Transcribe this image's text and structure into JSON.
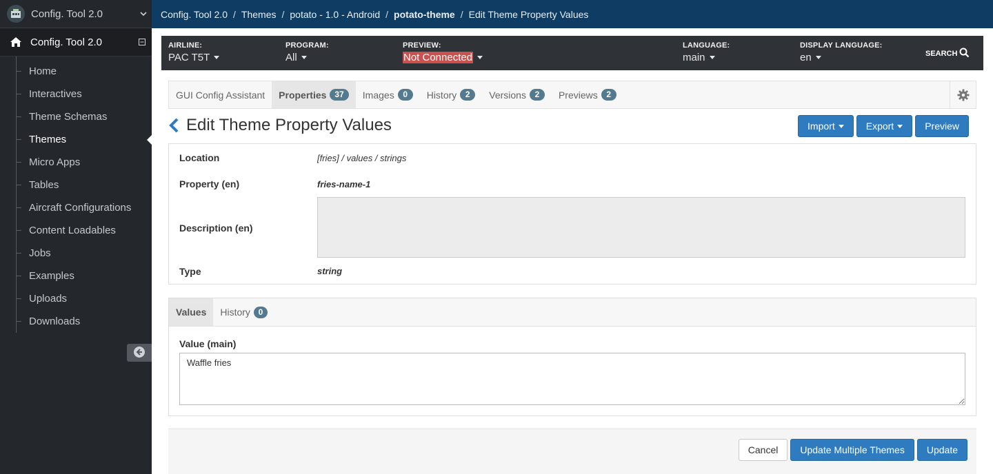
{
  "sidebar": {
    "app_switcher_title": "Config. Tool 2.0",
    "app_title": "Config. Tool 2.0",
    "items": [
      {
        "label": "Home",
        "active": false
      },
      {
        "label": "Interactives",
        "active": false
      },
      {
        "label": "Theme Schemas",
        "active": false
      },
      {
        "label": "Themes",
        "active": true
      },
      {
        "label": "Micro Apps",
        "active": false
      },
      {
        "label": "Tables",
        "active": false
      },
      {
        "label": "Aircraft Configurations",
        "active": false
      },
      {
        "label": "Content Loadables",
        "active": false
      },
      {
        "label": "Jobs",
        "active": false
      },
      {
        "label": "Examples",
        "active": false
      },
      {
        "label": "Uploads",
        "active": false
      },
      {
        "label": "Downloads",
        "active": false
      }
    ]
  },
  "breadcrumb": [
    "Config. Tool 2.0",
    "Themes",
    "potato - 1.0 - Android",
    "potato-theme",
    "Edit Theme Property Values"
  ],
  "filters": {
    "airline": {
      "label": "AIRLINE:",
      "value": "PAC T5T"
    },
    "program": {
      "label": "PROGRAM:",
      "value": "All"
    },
    "preview": {
      "label": "PREVIEW:",
      "value": "Not Connected"
    },
    "language": {
      "label": "LANGUAGE:",
      "value": "main"
    },
    "display_language": {
      "label": "DISPLAY LANGUAGE:",
      "value": "en"
    },
    "search_label": "SEARCH"
  },
  "tabs": [
    {
      "label": "GUI Config Assistant",
      "count": null,
      "active": false
    },
    {
      "label": "Properties",
      "count": "37",
      "active": true
    },
    {
      "label": "Images",
      "count": "0",
      "active": false
    },
    {
      "label": "History",
      "count": "2",
      "active": false
    },
    {
      "label": "Versions",
      "count": "2",
      "active": false
    },
    {
      "label": "Previews",
      "count": "2",
      "active": false
    }
  ],
  "page": {
    "title": "Edit Theme Property Values",
    "import_label": "Import",
    "export_label": "Export",
    "preview_label": "Preview"
  },
  "details": {
    "location_label": "Location",
    "location_value": "[fries] / values / strings",
    "property_label": "Property (en)",
    "property_value": "fries-name-1",
    "description_label": "Description (en)",
    "type_label": "Type",
    "type_value": "string"
  },
  "values_panel": {
    "tab_values": "Values",
    "tab_history": "History",
    "history_count": "0",
    "value_label": "Value (main)",
    "value_text": "Waffle fries"
  },
  "footer": {
    "cancel_label": "Cancel",
    "update_multiple_label": "Update Multiple Themes",
    "update_label": "Update"
  },
  "colors": {
    "topbar": "#0f3c63",
    "sidebar": "#24272c",
    "primary": "#2e7bbf",
    "badge": "#537a8f",
    "alert": "#c9524f"
  }
}
